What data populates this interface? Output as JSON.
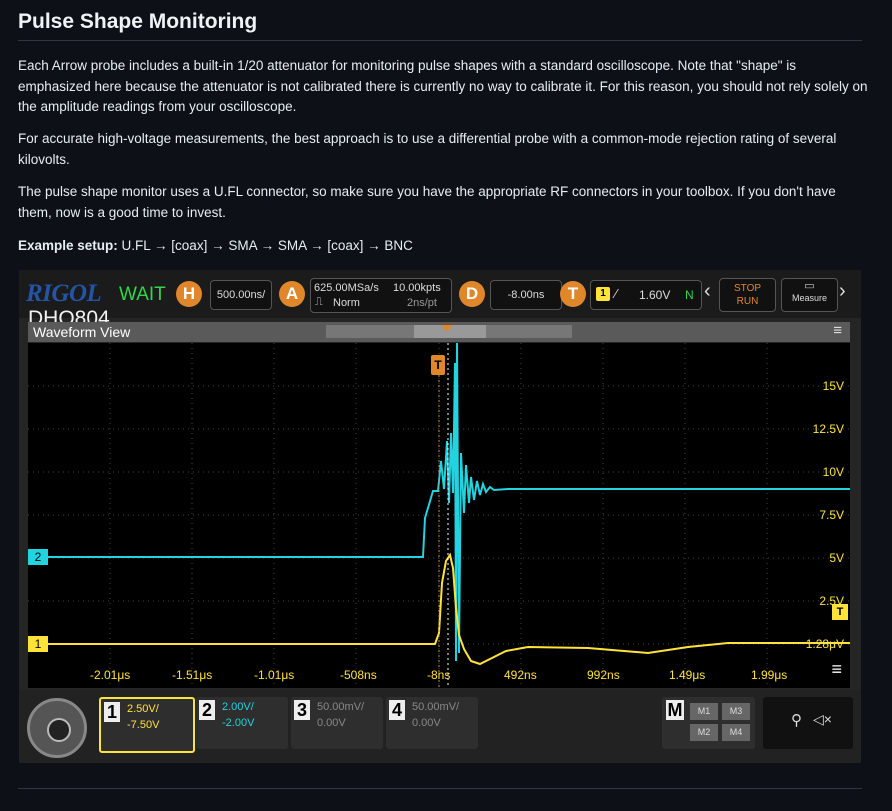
{
  "heading": "Pulse Shape Monitoring",
  "paragraphs": [
    "Each Arrow probe includes a built-in 1/20 attenuator for monitoring pulse shapes with a standard oscilloscope. Note that \"shape\" is emphasized here because the attenuator is not calibrated there is currently no way to calibrate it. For this reason, you should not rely solely on the amplitude readings from your oscilloscope.",
    "For accurate high-voltage measurements, the best approach is to use a differential probe with a common-mode rejection rating of several kilovolts.",
    "The pulse shape monitor uses a U.FL connector, so make sure you have the appropriate RF connectors in your toolbox. If you don't have them, now is a good time to invest."
  ],
  "example": {
    "label": "Example setup:",
    "text": "U.FL → [coax] → SMA → SMA → [coax] → BNC"
  },
  "scope": {
    "brand": "RIGOL",
    "status": "WAIT",
    "model": "DHO804",
    "horizontal": {
      "badge": "H",
      "value": "500.00ns/"
    },
    "acquire": {
      "badge": "A",
      "rate": "625.00MSa/s",
      "points": "10.00kpts",
      "mode": "Norm",
      "per_pt": "2ns/pt"
    },
    "delay": {
      "badge": "D",
      "value": "-8.00ns"
    },
    "trigger": {
      "badge": "T",
      "channel": "1",
      "level": "1.60V",
      "coupling": "N"
    },
    "stop_run": {
      "line1": "STOP",
      "line2": "RUN"
    },
    "measure_label": "Measure",
    "waveform_view_label": "Waveform View",
    "trigger_marker": "T",
    "y_labels": [
      "15V",
      "12.5V",
      "10V",
      "7.5V",
      "5V",
      "2.5V",
      "1.28μV"
    ],
    "x_labels": [
      "-2.01μs",
      "-1.51μs",
      "-1.01μs",
      "-508ns",
      "-8ns",
      "492ns",
      "992ns",
      "1.49μs",
      "1.99μs"
    ],
    "channels": [
      {
        "num": "1",
        "scale": "2.50V/",
        "offset": "-7.50V",
        "color": "#ffe33b"
      },
      {
        "num": "2",
        "scale": "2.00V/",
        "offset": "-2.00V",
        "color": "#22d3e0"
      },
      {
        "num": "3",
        "scale": "50.00mV/",
        "offset": "0.00V",
        "color": "#888888"
      },
      {
        "num": "4",
        "scale": "50.00mV/",
        "offset": "0.00V",
        "color": "#888888"
      }
    ],
    "math": {
      "label": "M",
      "buttons": [
        "M1",
        "M3",
        "M2",
        "M4"
      ]
    },
    "marker_ch1": "1",
    "marker_ch2": "2"
  }
}
